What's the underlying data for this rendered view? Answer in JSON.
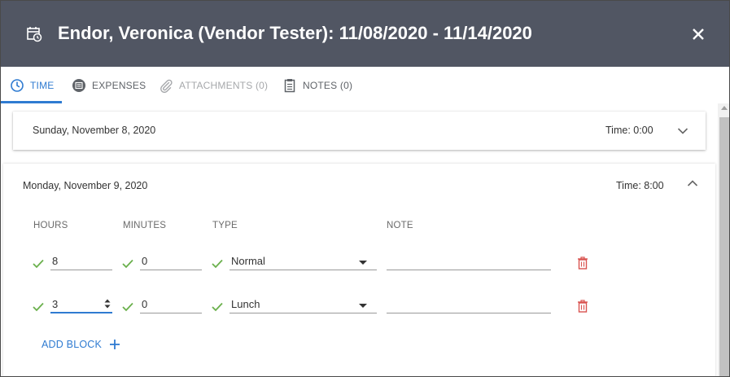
{
  "dialog": {
    "title": "Endor, Veronica (Vendor Tester): 11/08/2020 - 11/14/2020",
    "header_icon": "timesheet-icon",
    "close_icon": "close-icon"
  },
  "tabs": [
    {
      "label": "TIME",
      "icon": "clock-icon",
      "state": "active"
    },
    {
      "label": "EXPENSES",
      "icon": "receipt-icon",
      "state": "normal"
    },
    {
      "label": "ATTACHMENTS (0)",
      "icon": "paperclip-icon",
      "state": "disabled"
    },
    {
      "label": "NOTES (0)",
      "icon": "notes-icon",
      "state": "normal"
    }
  ],
  "days": [
    {
      "date": "Sunday, November 8, 2020",
      "time": "Time: 0:00",
      "expanded": false
    },
    {
      "date": "Monday, November 9, 2020",
      "time": "Time: 8:00",
      "expanded": true
    }
  ],
  "columns": {
    "hours": "HOURS",
    "minutes": "MINUTES",
    "type": "TYPE",
    "note": "NOTE"
  },
  "blocks": [
    {
      "hours": "8",
      "minutes": "0",
      "type": "Normal",
      "note": ""
    },
    {
      "hours": "3",
      "minutes": "0",
      "type": "Lunch",
      "note": ""
    }
  ],
  "add_block_label": "ADD BLOCK",
  "colors": {
    "header_bg": "#515663",
    "accent": "#2f7bd1",
    "valid_check": "#6ab04c",
    "delete": "#d9534f"
  }
}
